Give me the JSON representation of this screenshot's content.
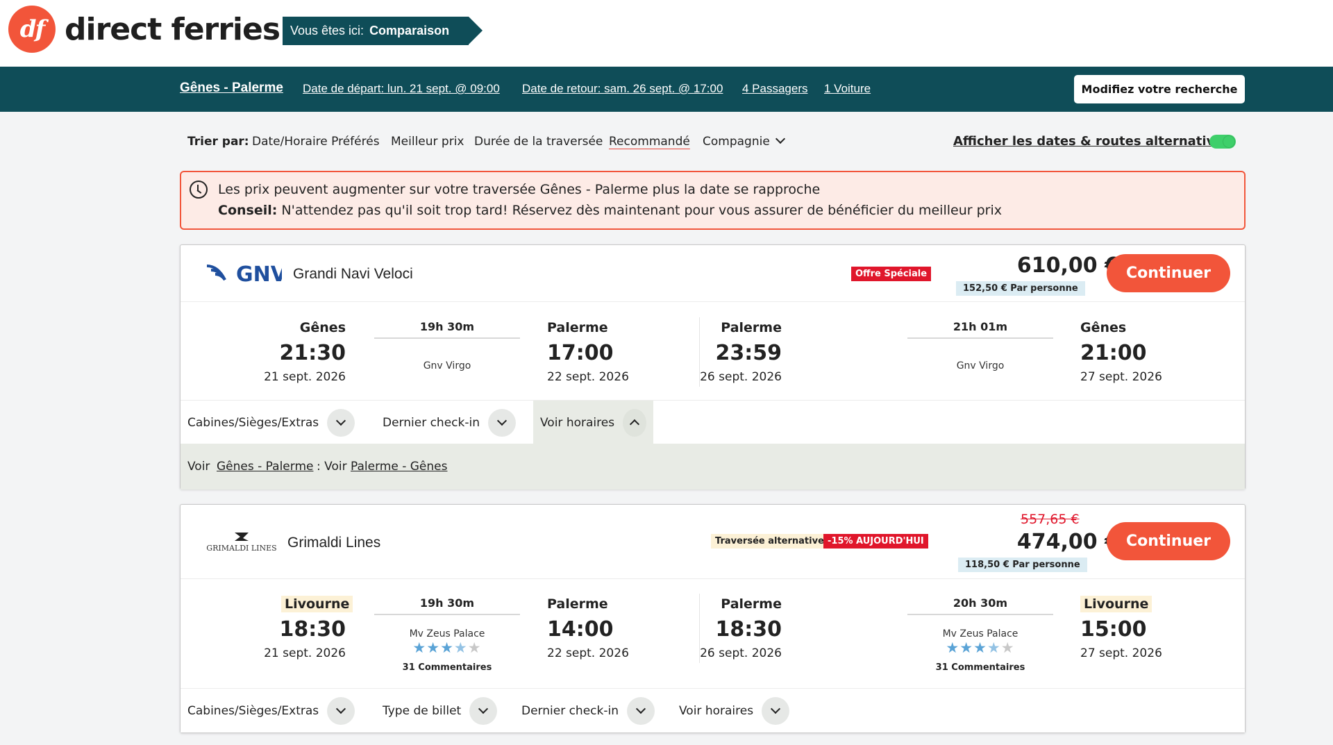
{
  "header": {
    "logo_mark": "df",
    "logo_text": "direct ferries",
    "breadcrumb_label": "Vous êtes ici:",
    "breadcrumb_current": "Comparaison"
  },
  "search": {
    "route": "Gênes - Palerme",
    "departure": "Date de départ: lun. 21 sept. @ 09:00",
    "return": "Date de retour: sam. 26 sept. @ 17:00",
    "passengers": "4 Passagers",
    "vehicle": "1 Voiture",
    "modify_label": "Modifiez votre recherche"
  },
  "sort": {
    "label": "Trier par:",
    "options": [
      "Date/Horaire Préférés",
      "Meilleur prix",
      "Durée de la traversée",
      "Recommandé",
      "Compagnie"
    ],
    "active": "Recommandé",
    "alt_label": "Afficher les dates & routes alternatives",
    "alt_enabled": true
  },
  "alert": {
    "line1": "Les prix peuvent augmenter sur votre traversée Gênes - Palerme plus la date se rapproche",
    "tip_label": "Conseil:",
    "tip_text": "N'attendez pas qu'il soit trop tard! Réservez dès maintenant pour vous assurer de bénéficier du meilleur prix"
  },
  "results": [
    {
      "operator_logo": "GNV",
      "operator": "Grandi Navi Veloci",
      "badges": [
        "Offre Spéciale"
      ],
      "price": "610,00 €",
      "per_person": "152,50 € Par personne",
      "continue_label": "Continuer",
      "outbound": {
        "from": "Gênes",
        "dep_time": "21:30",
        "dep_date": "21 sept. 2026",
        "duration": "19h 30m",
        "ship": "Gnv Virgo",
        "to": "Palerme",
        "arr_time": "17:00",
        "arr_date": "22 sept. 2026"
      },
      "inbound": {
        "from": "Palerme",
        "dep_time": "23:59",
        "dep_date": "26 sept. 2026",
        "duration": "21h 01m",
        "ship": "Gnv Virgo",
        "to": "Gênes",
        "arr_time": "21:00",
        "arr_date": "27 sept. 2026"
      },
      "tabs": [
        "Cabines/Sièges/Extras",
        "Dernier check-in",
        "Voir horaires"
      ],
      "schedule": {
        "prefix": "Voir",
        "link1": "Gênes - Palerme",
        "sep": ": Voir",
        "link2": "Palerme - Gênes"
      }
    },
    {
      "operator_logo": "GRIMALDI LINES",
      "operator": "Grimaldi Lines",
      "badges": [
        "Traversée alternative",
        "-15% AUJOURD'HUI"
      ],
      "old_price": "557,65 €",
      "price": "474,00 €",
      "per_person": "118,50 € Par personne",
      "continue_label": "Continuer",
      "outbound": {
        "from": "Livourne",
        "dep_time": "18:30",
        "dep_date": "21 sept. 2026",
        "duration": "19h 30m",
        "ship": "Mv Zeus Palace",
        "rating": 3.5,
        "reviews": "31 Commentaires",
        "to": "Palerme",
        "arr_time": "14:00",
        "arr_date": "22 sept. 2026"
      },
      "inbound": {
        "from": "Palerme",
        "dep_time": "18:30",
        "dep_date": "26 sept. 2026",
        "duration": "20h 30m",
        "ship": "Mv Zeus Palace",
        "rating": 3.5,
        "reviews": "31 Commentaires",
        "to": "Livourne",
        "arr_time": "15:00",
        "arr_date": "27 sept. 2026"
      },
      "tabs": [
        "Cabines/Sièges/Extras",
        "Type de billet",
        "Dernier check-in",
        "Voir horaires"
      ]
    }
  ],
  "colors": {
    "brand_teal": "#0f4d58",
    "brand_orange": "#f2553a",
    "badge_red": "#e0162b",
    "star_blue": "#5aa3d6"
  }
}
